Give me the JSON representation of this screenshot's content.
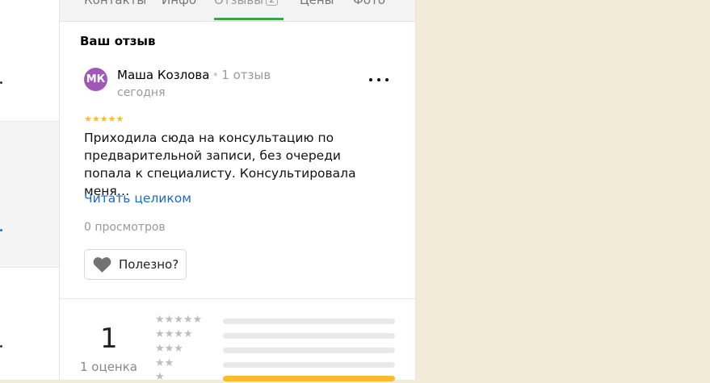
{
  "tabs": [
    {
      "label": "Контакты"
    },
    {
      "label": "Инфо"
    },
    {
      "label": "Отзывы",
      "badge": "2",
      "active": true
    },
    {
      "label": "Цены"
    },
    {
      "label": "Фото"
    }
  ],
  "section_title": "Ваш отзыв",
  "review": {
    "avatar_initials": "МК",
    "avatar_color": "#a257b8",
    "author": "Маша Козлова",
    "author_reviews": "1 отзыв",
    "date": "сегодня",
    "stars": "★★★★★",
    "rating": 5,
    "text": "Приходила сюда на консультацию по предварительной записи, без очереди попала к специалисту. Консультировала меня…",
    "read_more": "Читать целиком",
    "views": "0 просмотров",
    "useful_label": "Полезно?"
  },
  "summary": {
    "rating": "1",
    "count_label": "1 оценка",
    "distribution": [
      {
        "stars": "★★★★★",
        "fraction": 0
      },
      {
        "stars": "★★★★",
        "fraction": 0
      },
      {
        "stars": "★★★",
        "fraction": 0
      },
      {
        "stars": "★★",
        "fraction": 0
      },
      {
        "stars": "★",
        "fraction": 1
      }
    ]
  },
  "colors": {
    "accent_green": "#3fa33f",
    "star_yellow": "#fbbb2c",
    "link_blue": "#1c6ac8",
    "background": "#f2ecd6"
  }
}
